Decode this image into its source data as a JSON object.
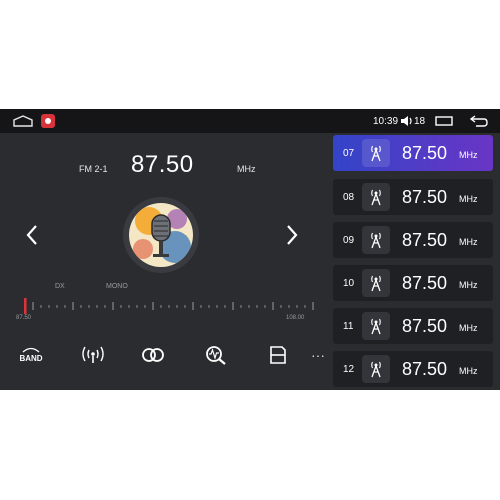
{
  "status_bar": {
    "clock": "10:39",
    "volume": "18"
  },
  "radio": {
    "band": "FM 2-1",
    "frequency": "87.50",
    "unit": "MHz",
    "dx_label": "DX",
    "mono_label": "MONO",
    "scale_min": "87.50",
    "scale_max": "108.00",
    "tuned_position": 0.0
  },
  "toolbar": {
    "band_label": "BAND",
    "more_label": "···"
  },
  "presets": [
    {
      "number": "07",
      "frequency": "87.50",
      "unit": "MHz",
      "active": true
    },
    {
      "number": "08",
      "frequency": "87.50",
      "unit": "MHz",
      "active": false
    },
    {
      "number": "09",
      "frequency": "87.50",
      "unit": "MHz",
      "active": false
    },
    {
      "number": "10",
      "frequency": "87.50",
      "unit": "MHz",
      "active": false
    },
    {
      "number": "11",
      "frequency": "87.50",
      "unit": "MHz",
      "active": false
    },
    {
      "number": "12",
      "frequency": "87.50",
      "unit": "MHz",
      "active": false
    }
  ],
  "colors": {
    "accent_start": "#3344c8",
    "accent_end": "#6a35c5",
    "tuner_needle": "#e0323a"
  },
  "icons": [
    "home-icon",
    "app-icon",
    "volume-icon",
    "recent-apps-icon",
    "back-icon",
    "prev-icon",
    "next-icon",
    "band-icon",
    "signal-icon",
    "stereo-icon",
    "scan-icon",
    "save-icon",
    "more-icon",
    "antenna-icon"
  ]
}
